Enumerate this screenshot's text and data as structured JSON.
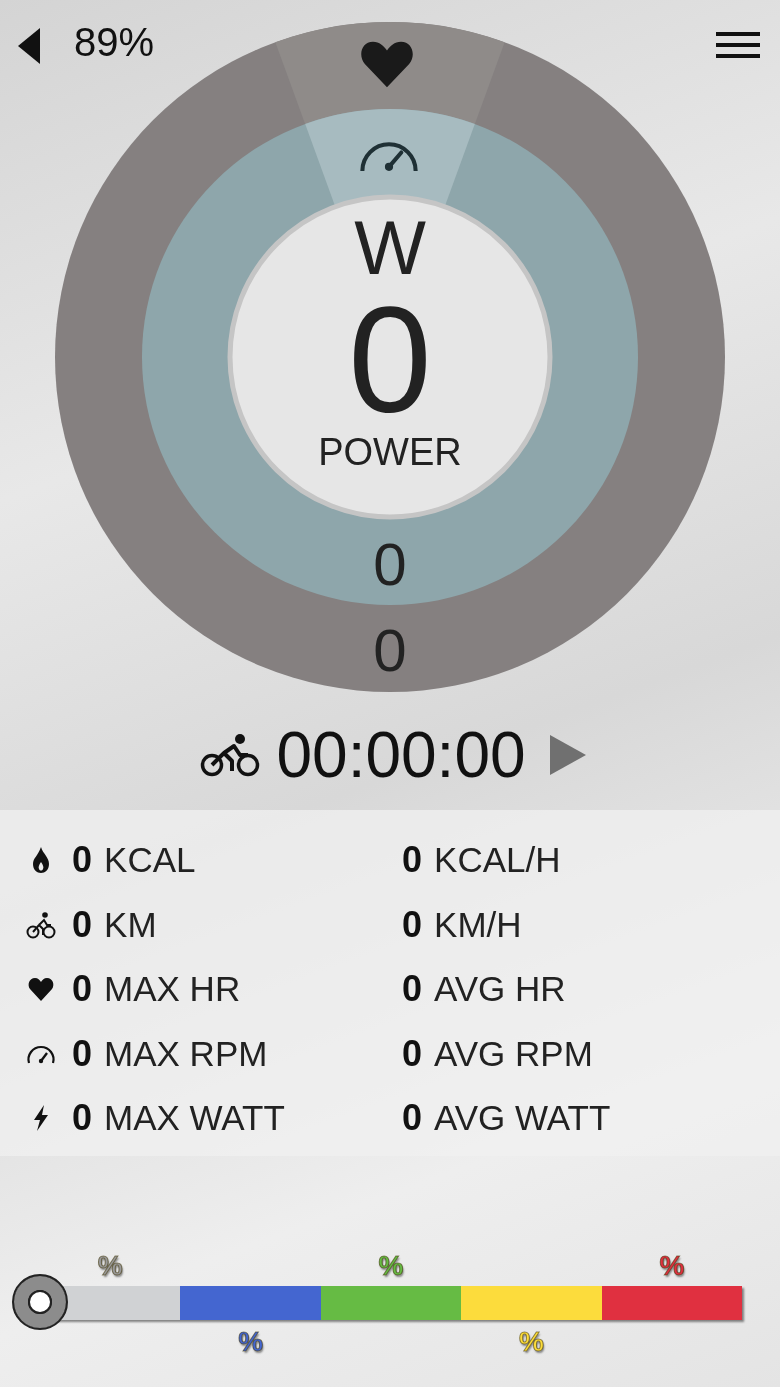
{
  "status": {
    "battery": "89%"
  },
  "gauge": {
    "unit": "W",
    "value": "0",
    "label": "POWER",
    "inner_reading": "0",
    "outer_reading": "0"
  },
  "timer": {
    "time": "00:00:00"
  },
  "stats": [
    {
      "kind": "flame",
      "value": "0",
      "unit": "KCAL",
      "rate_value": "0",
      "rate_unit": "KCAL/H"
    },
    {
      "kind": "bike",
      "value": "0",
      "unit": "KM",
      "rate_value": "0",
      "rate_unit": "KM/H"
    },
    {
      "kind": "heart",
      "value": "0",
      "unit": "MAX HR",
      "rate_value": "0",
      "rate_unit": "AVG HR"
    },
    {
      "kind": "gauge",
      "value": "0",
      "unit": "MAX RPM",
      "rate_value": "0",
      "rate_unit": "AVG RPM"
    },
    {
      "kind": "bolt",
      "value": "0",
      "unit": "MAX WATT",
      "rate_value": "0",
      "rate_unit": "AVG WATT"
    }
  ],
  "zones": {
    "level": 0,
    "items": [
      {
        "label": "%",
        "color": "#d0d2d4"
      },
      {
        "label": "%",
        "color": "#4466d0"
      },
      {
        "label": "%",
        "color": "#66bb44"
      },
      {
        "label": "%",
        "color": "#fcdc3c"
      },
      {
        "label": "%",
        "color": "#e03040"
      }
    ]
  }
}
